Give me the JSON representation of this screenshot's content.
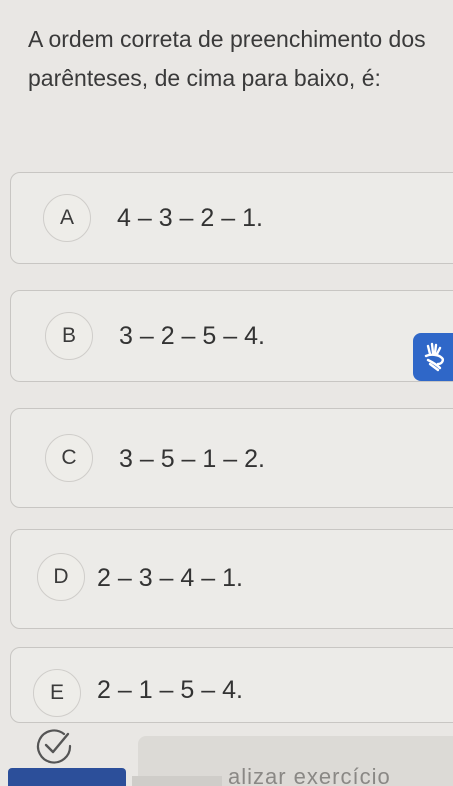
{
  "question": {
    "text": "A ordem correta de preenchimento dos parênteses, de cima para baixo, é:"
  },
  "options": [
    {
      "letter": "A",
      "text": "4 – 3 – 2 – 1."
    },
    {
      "letter": "B",
      "text": "3 – 2 – 5 – 4."
    },
    {
      "letter": "C",
      "text": "3 – 5 – 1 – 2."
    },
    {
      "letter": "D",
      "text": "2 – 3 – 4 – 1."
    },
    {
      "letter": "E",
      "text": "2 – 1 – 5 – 4."
    }
  ],
  "accessibility": {
    "icon": "sign-language-icon",
    "color": "#2f67c8"
  },
  "footer": {
    "check_icon": "check-circle-icon",
    "finish_label": "alizar exercício",
    "accent_color": "#2c4f9a"
  }
}
